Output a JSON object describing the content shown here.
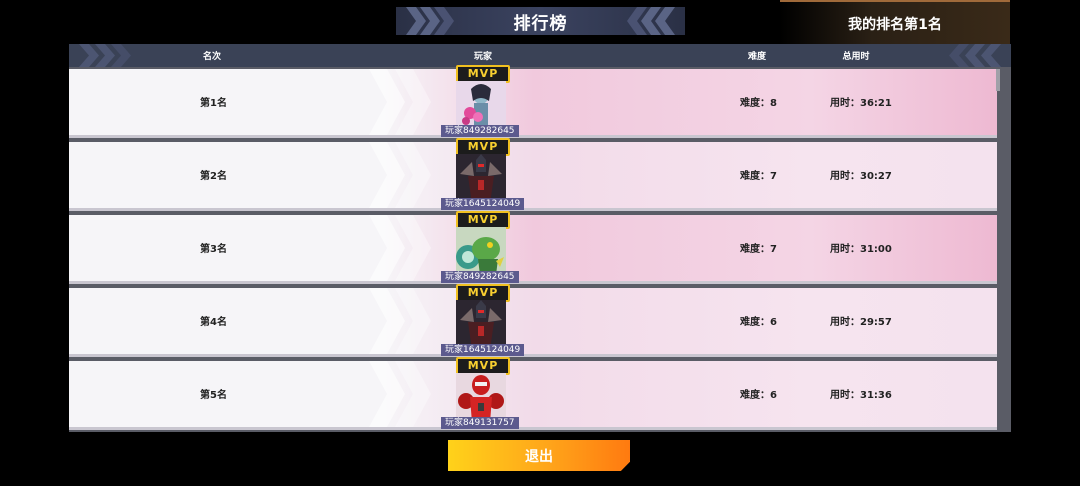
{
  "title": "排行榜",
  "my_rank": "我的排名第1名",
  "columns": {
    "rank": "名次",
    "player": "玩家",
    "difficulty": "难度",
    "time": "总用时"
  },
  "mvp_label": "MVP",
  "rows": [
    {
      "rank": "第1名",
      "player": "玩家849282645",
      "difficulty": "难度：8",
      "time": "用时：36:21",
      "avatar": "pink-hair-warrior"
    },
    {
      "rank": "第2名",
      "player": "玩家1645124049",
      "difficulty": "难度：7",
      "time": "用时：30:27",
      "avatar": "dark-armored-demon"
    },
    {
      "rank": "第3名",
      "player": "玩家849282645",
      "difficulty": "难度：7",
      "time": "用时：31:00",
      "avatar": "green-beast"
    },
    {
      "rank": "第4名",
      "player": "玩家1645124049",
      "difficulty": "难度：6",
      "time": "用时：29:57",
      "avatar": "dark-armored-demon"
    },
    {
      "rank": "第5名",
      "player": "玩家849131757",
      "difficulty": "难度：6",
      "time": "用时：31:36",
      "avatar": "red-armored-hero"
    }
  ],
  "exit_label": "退出",
  "colors": {
    "accent": "#ffa51a",
    "header": "#3a4256",
    "name_tag": "#5c5a8e",
    "mvp_gold": "#f0c020"
  }
}
